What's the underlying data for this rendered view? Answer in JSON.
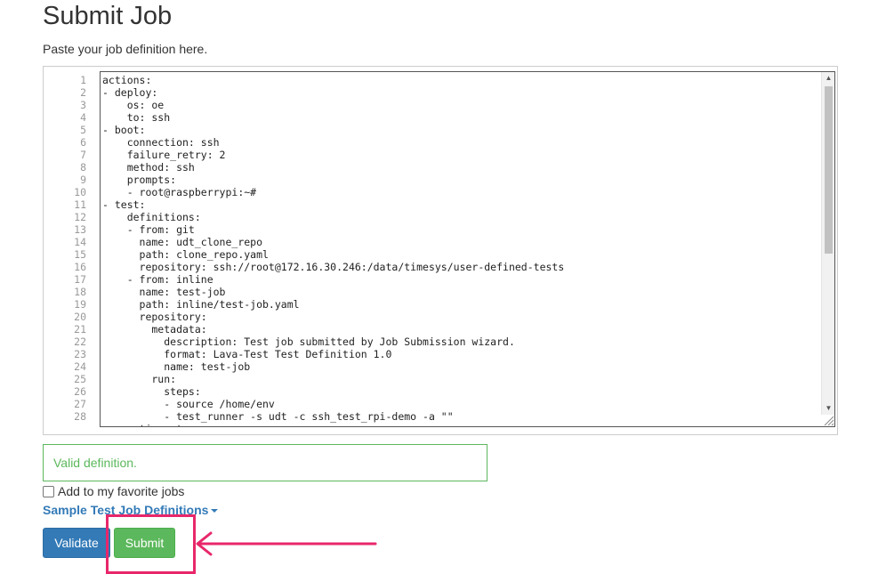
{
  "page": {
    "title": "Submit Job",
    "subtitle": "Paste your job definition here."
  },
  "editor": {
    "line_numbers": [
      "1",
      "2",
      "3",
      "4",
      "5",
      "6",
      "7",
      "8",
      "9",
      "10",
      "11",
      "12",
      "13",
      "14",
      "15",
      "16",
      "17",
      "18",
      "19",
      "20",
      "21",
      "22",
      "23",
      "24",
      "25",
      "26",
      "27",
      "28"
    ],
    "lines": [
      "actions:",
      "- deploy:",
      "    os: oe",
      "    to: ssh",
      "- boot:",
      "    connection: ssh",
      "    failure_retry: 2",
      "    method: ssh",
      "    prompts:",
      "    - root@raspberrypi:~#",
      "- test:",
      "    definitions:",
      "    - from: git",
      "      name: udt_clone_repo",
      "      path: clone_repo.yaml",
      "      repository: ssh://root@172.16.30.246:/data/timesys/user-defined-tests",
      "    - from: inline",
      "      name: test-job",
      "      path: inline/test-job.yaml",
      "      repository:",
      "        metadata:",
      "          description: Test job submitted by Job Submission wizard.",
      "          format: Lava-Test Test Definition 1.0",
      "          name: test-job",
      "        run:",
      "          steps:",
      "          - source /home/env",
      "          - test_runner -s udt -c ssh_test_rpi-demo -a \"\"",
      "      timeout:"
    ]
  },
  "validation": {
    "message": "Valid definition."
  },
  "favorite": {
    "label": "Add to my favorite jobs",
    "checked": false
  },
  "samples": {
    "label": "Sample Test Job Definitions"
  },
  "buttons": {
    "validate": "Validate",
    "submit": "Submit"
  },
  "colors": {
    "primary": "#337ab7",
    "success": "#5cb85c",
    "annotation": "#e8276b"
  }
}
